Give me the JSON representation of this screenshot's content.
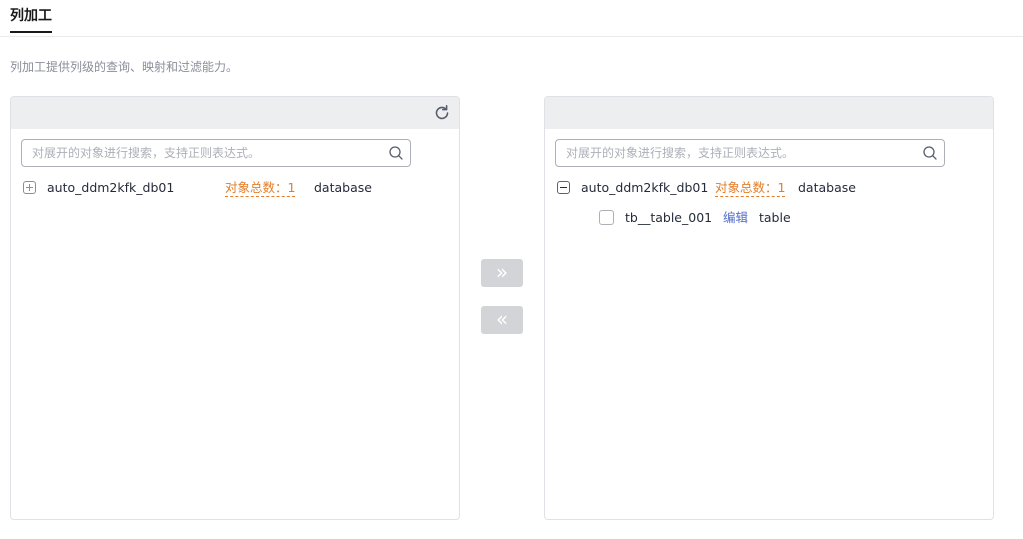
{
  "tab": {
    "label": "列加工"
  },
  "description": "列加工提供列级的查询、映射和过滤能力。",
  "left_panel": {
    "search_placeholder": "对展开的对象进行搜索，支持正则表达式。",
    "node": {
      "name": "auto_ddm2kfk_db01",
      "count_label": "对象总数：1",
      "type": "database",
      "expanded": false
    }
  },
  "right_panel": {
    "search_placeholder": "对展开的对象进行搜索，支持正则表达式。",
    "node": {
      "name": "auto_ddm2kfk_db01",
      "count_label": "对象总数：1",
      "type": "database",
      "expanded": true,
      "children": [
        {
          "name": "tb__table_001",
          "edit_label": "编辑",
          "type": "table",
          "checked": false
        }
      ]
    }
  },
  "buttons": {
    "move_right": "»",
    "move_left": "«"
  },
  "colors": {
    "accent_count": "#e37d29",
    "link": "#526ecc",
    "panel_header": "#eceef0",
    "disabled_button": "#d3d4d7"
  }
}
